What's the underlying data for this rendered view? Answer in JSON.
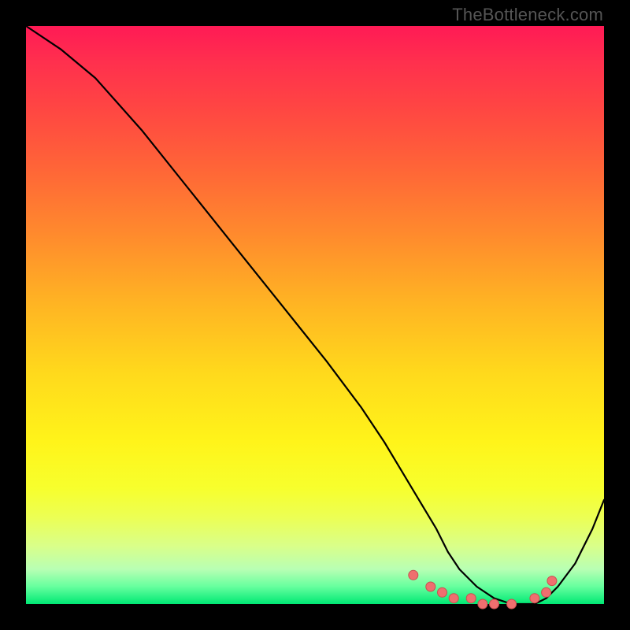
{
  "watermark": "TheBottleneck.com",
  "colors": {
    "curve": "#000000",
    "marker_fill": "#ef6f6f",
    "marker_stroke": "#c94f4f",
    "gradient_top": "#ff1a55",
    "gradient_bottom": "#00e874"
  },
  "chart_data": {
    "type": "line",
    "title": "",
    "xlabel": "",
    "ylabel": "",
    "xlim": [
      0,
      100
    ],
    "ylim": [
      0,
      100
    ],
    "grid": false,
    "legend": false,
    "series": [
      {
        "name": "bottleneck-curve",
        "x": [
          0,
          6,
          12,
          20,
          28,
          36,
          44,
          52,
          58,
          62,
          65,
          68,
          71,
          73,
          75,
          78,
          81,
          84,
          86,
          88,
          90,
          92,
          95,
          98,
          100
        ],
        "values": [
          100,
          96,
          91,
          82,
          72,
          62,
          52,
          42,
          34,
          28,
          23,
          18,
          13,
          9,
          6,
          3,
          1,
          0,
          0,
          0,
          1,
          3,
          7,
          13,
          18
        ]
      }
    ],
    "markers": {
      "name": "highlight-dots",
      "x": [
        67,
        70,
        72,
        74,
        77,
        79,
        81,
        84,
        88,
        90,
        91
      ],
      "values": [
        5,
        3,
        2,
        1,
        1,
        0,
        0,
        0,
        1,
        2,
        4
      ]
    }
  }
}
